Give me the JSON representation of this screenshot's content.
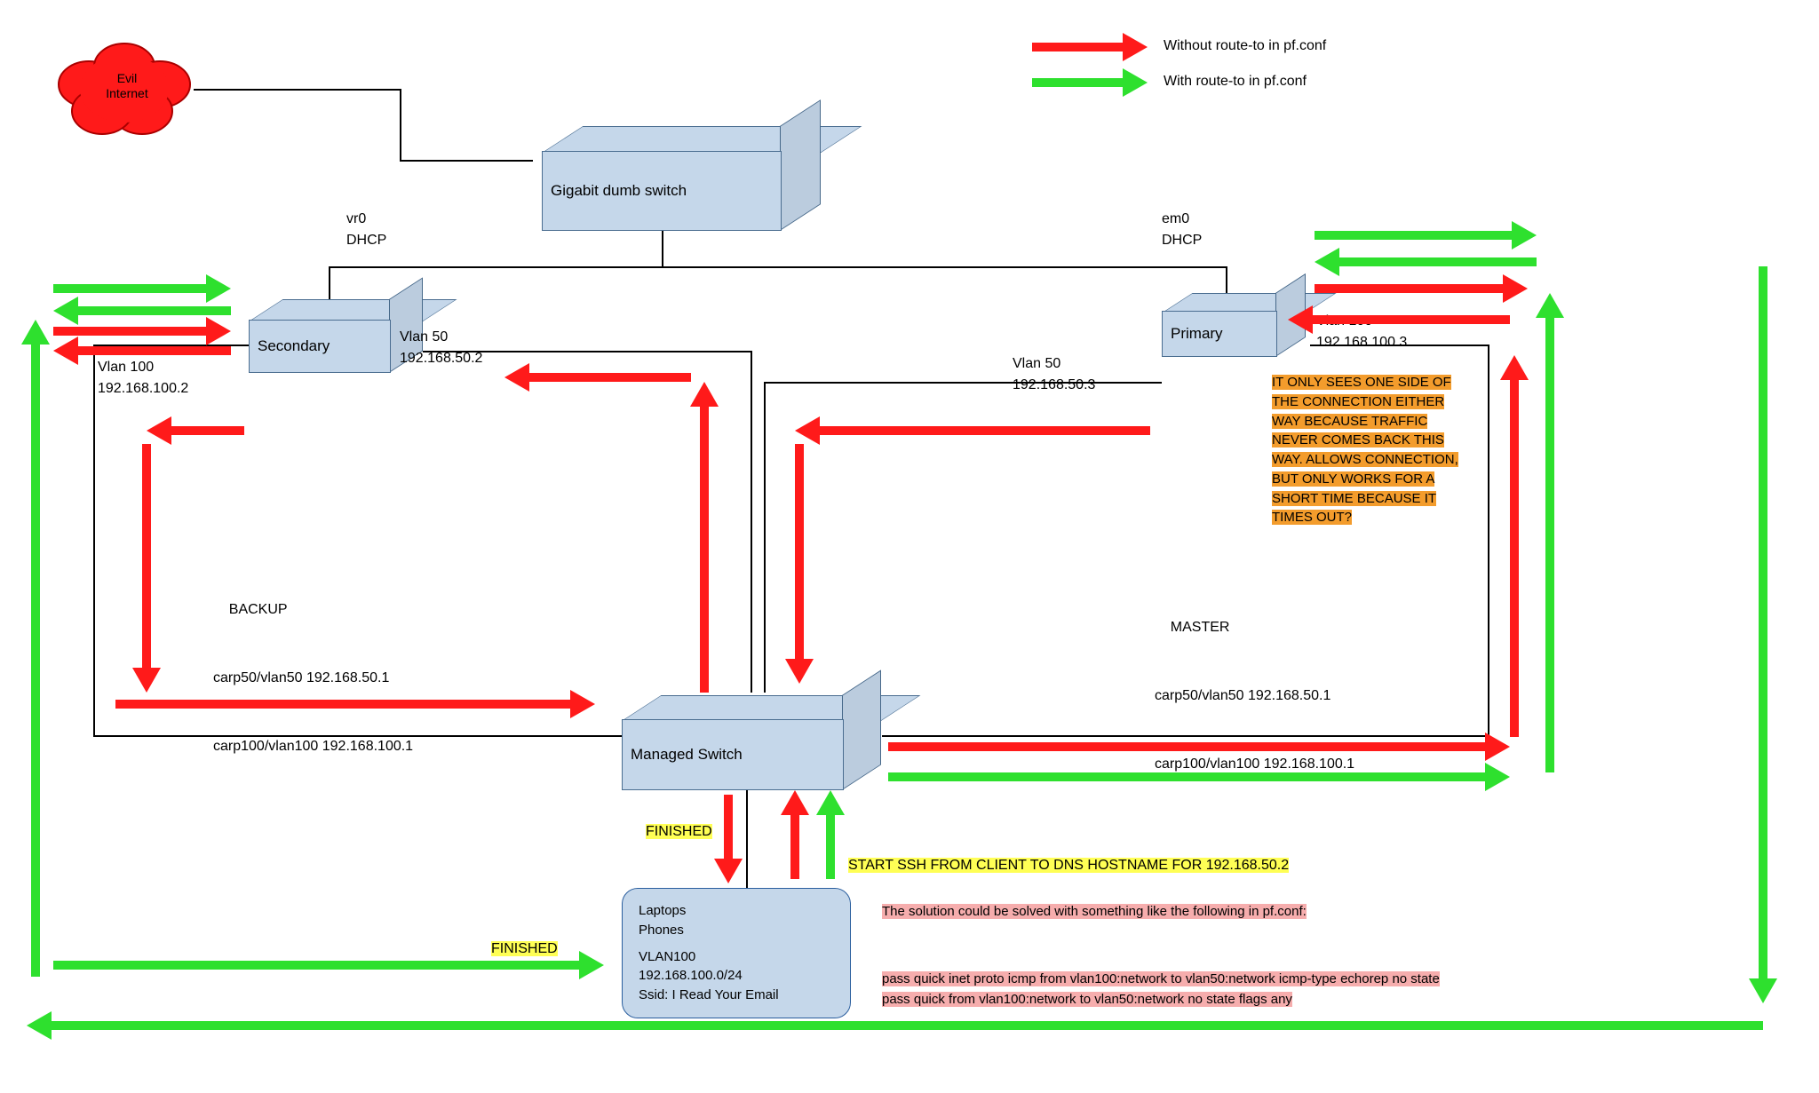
{
  "legend": {
    "without": "Without route-to in pf.conf",
    "with": "With route-to in pf.conf"
  },
  "cloud": {
    "line1": "Evil",
    "line2": "Internet"
  },
  "nodes": {
    "dumb_switch": "Gigabit dumb switch",
    "secondary": "Secondary",
    "primary": "Primary",
    "managed_switch": "Managed Switch"
  },
  "iface": {
    "vr0": "vr0\nDHCP",
    "em0": "em0\nDHCP",
    "sec_vlan50": "Vlan 50\n192.168.50.2",
    "sec_vlan100": "Vlan 100\n192.168.100.2",
    "pri_vlan50": "Vlan 50\n192.168.50.3",
    "pri_vlan100": "Vlan 100\n192.168.100.3"
  },
  "carp": {
    "backup_title": "BACKUP",
    "backup_l1": "carp50/vlan50 192.168.50.1",
    "backup_l2": "carp100/vlan100 192.168.100.1",
    "master_title": "MASTER",
    "master_l1": "carp50/vlan50 192.168.50.1",
    "master_l2": "carp100/vlan100 192.168.100.1"
  },
  "note_orange": "IT ONLY SEES ONE SIDE OF THE CONNECTION EITHER WAY BECAUSE TRAFFIC NEVER COMES BACK THIS WAY. ALLOWS CONNECTION, BUT ONLY WORKS FOR A SHORT TIME BECAUSE IT TIMES OUT?",
  "finished": "FINISHED",
  "start_ssh": "START SSH FROM CLIENT TO DNS HOSTNAME FOR 192.168.50.2",
  "clients": {
    "l1": "Laptops",
    "l2": "Phones",
    "l3": "VLAN100",
    "l4": "192.168.100.0/24",
    "l5": "Ssid: I Read Your Email"
  },
  "solution": {
    "intro": "The solution could be solved with something like the following in pf.conf:",
    "rule1": "pass quick inet proto icmp from vlan100:network to vlan50:network icmp-type echorep no state",
    "rule2": "pass quick from vlan100:network to vlan50:network no state flags any"
  },
  "colors": {
    "red": "#ff1a1a",
    "green": "#2ee02e",
    "box_fill": "#c5d7ea",
    "box_stroke": "#4a6d90",
    "orange": "#f39c2c",
    "yellow": "#ffff55",
    "pink": "#f6adad"
  }
}
